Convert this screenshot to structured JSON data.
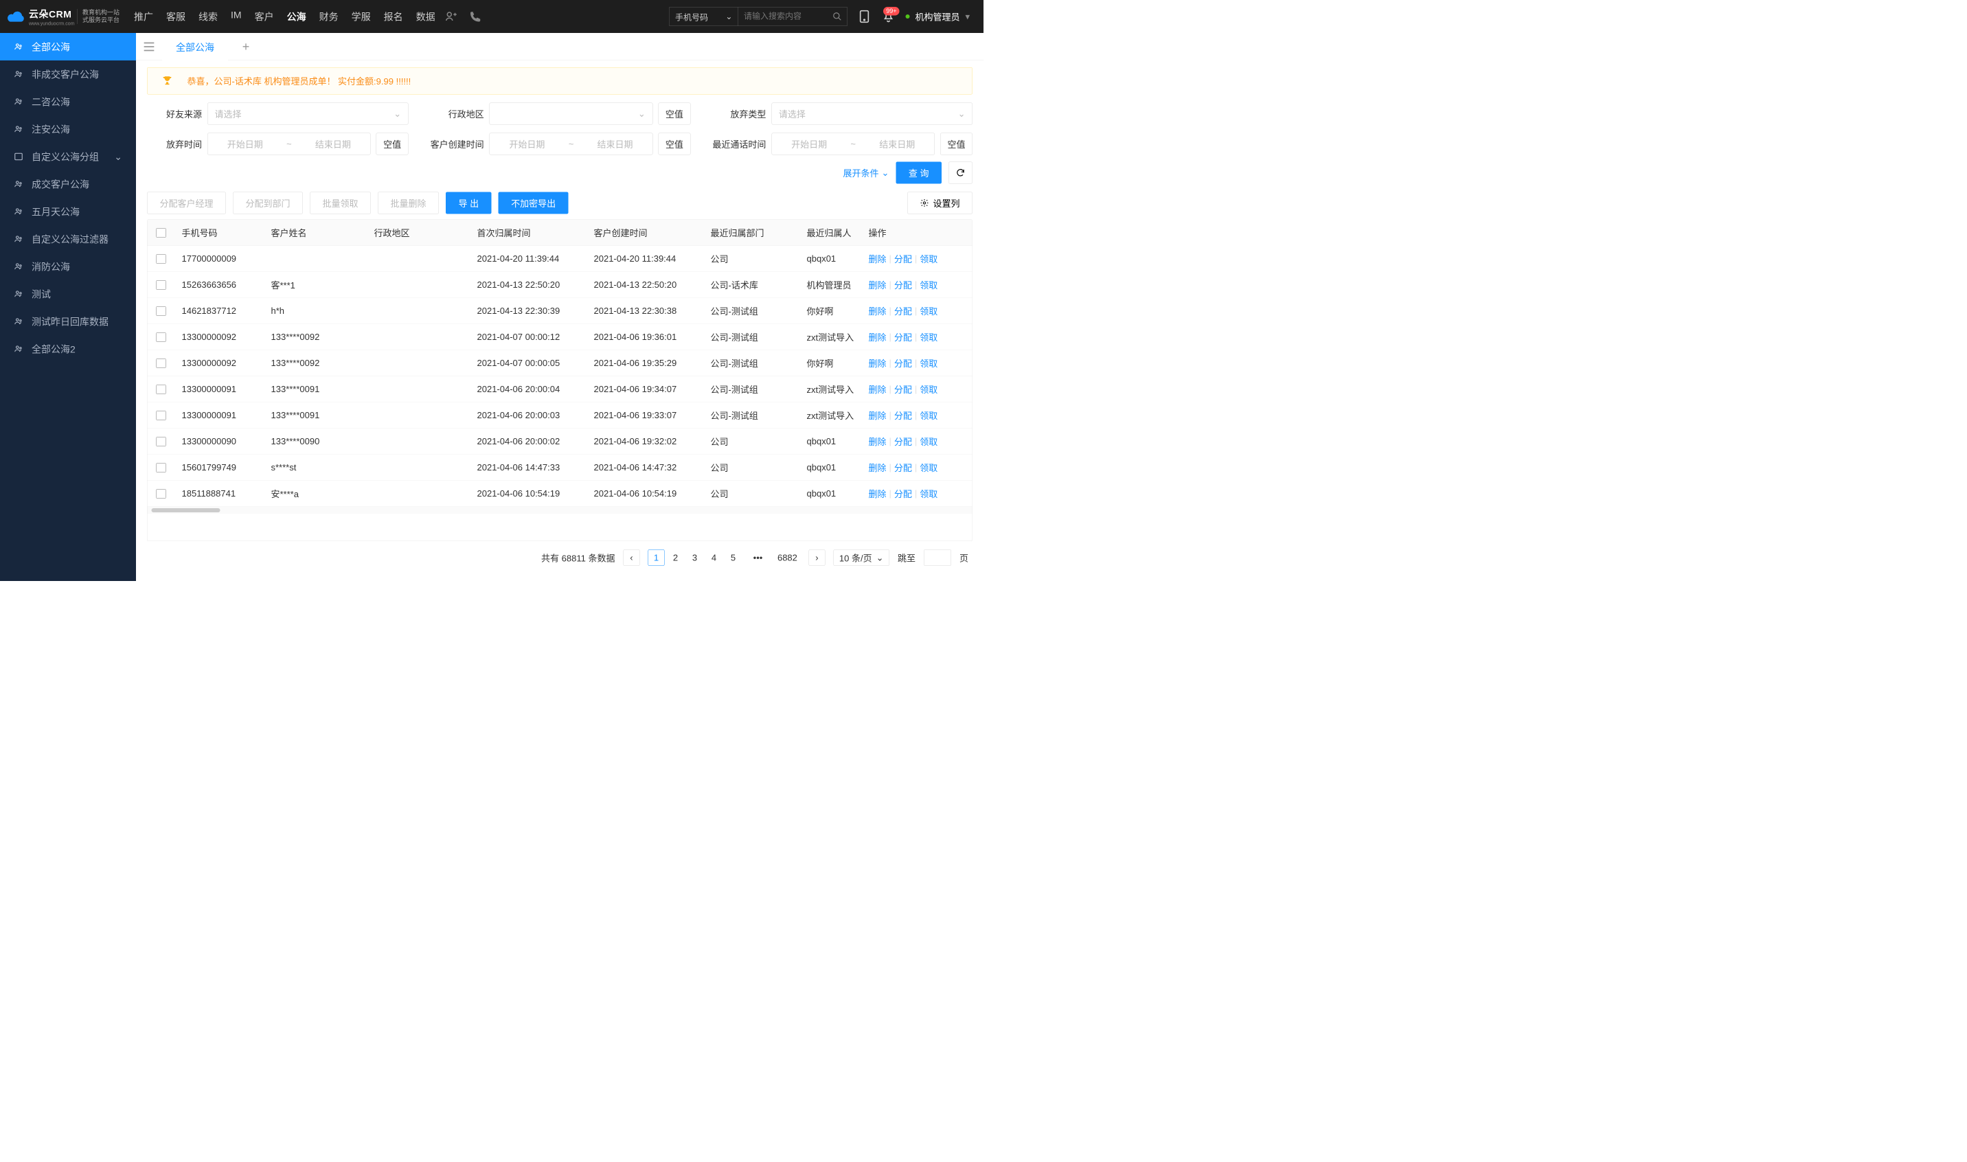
{
  "header": {
    "logo_main": "云朵CRM",
    "logo_url": "www.yunduocrm.com",
    "logo_sub1": "教育机构一站",
    "logo_sub2": "式服务云平台",
    "nav": [
      "推广",
      "客服",
      "线索",
      "IM",
      "客户",
      "公海",
      "财务",
      "学服",
      "报名",
      "数据"
    ],
    "nav_active_index": 5,
    "search_type": "手机号码",
    "search_placeholder": "请输入搜索内容",
    "notif_badge": "99+",
    "user_label": "机构管理员"
  },
  "sidebar": {
    "items": [
      {
        "label": "全部公海",
        "active": true,
        "icon": "users"
      },
      {
        "label": "非成交客户公海",
        "icon": "users"
      },
      {
        "label": "二咨公海",
        "icon": "users"
      },
      {
        "label": "注安公海",
        "icon": "users"
      },
      {
        "label": "自定义公海分组",
        "icon": "folder",
        "expandable": true
      },
      {
        "label": "成交客户公海",
        "icon": "users"
      },
      {
        "label": "五月天公海",
        "icon": "users"
      },
      {
        "label": "自定义公海过滤器",
        "icon": "users"
      },
      {
        "label": "消防公海",
        "icon": "users"
      },
      {
        "label": "测试",
        "icon": "users"
      },
      {
        "label": "测试昨日回库数据",
        "icon": "users"
      },
      {
        "label": "全部公海2",
        "icon": "users"
      }
    ]
  },
  "tabs": {
    "items": [
      "全部公海"
    ],
    "active_index": 0
  },
  "banner": {
    "text": "恭喜，公司-话术库  机构管理员成单！  实付金额:9.99 !!!!!!"
  },
  "filters": {
    "friend_source": {
      "label": "好友来源",
      "placeholder": "请选择"
    },
    "admin_region": {
      "label": "行政地区",
      "placeholder": ""
    },
    "abandon_type": {
      "label": "放弃类型",
      "placeholder": "请选择"
    },
    "abandon_time": {
      "label": "放弃时间",
      "start": "开始日期",
      "end": "结束日期"
    },
    "customer_create_time": {
      "label": "客户创建时间",
      "start": "开始日期",
      "end": "结束日期"
    },
    "last_call_time": {
      "label": "最近通话时间",
      "start": "开始日期",
      "end": "结束日期"
    },
    "null_btn": "空值",
    "expand_label": "展开条件",
    "query_label": "查 询"
  },
  "actions": {
    "assign_manager": "分配客户经理",
    "assign_dept": "分配到部门",
    "batch_claim": "批量领取",
    "batch_delete": "批量删除",
    "export": "导 出",
    "export_plain": "不加密导出",
    "settings_col": "设置列"
  },
  "table": {
    "headers": {
      "phone": "手机号码",
      "name": "客户姓名",
      "region": "行政地区",
      "first_time": "首次归属时间",
      "create_time": "客户创建时间",
      "dept": "最近归属部门",
      "person": "最近归属人",
      "ops": "操作"
    },
    "ops": {
      "delete": "删除",
      "assign": "分配",
      "claim": "领取"
    },
    "rows": [
      {
        "phone": "17700000009",
        "name": "",
        "region": "",
        "first_time": "2021-04-20 11:39:44",
        "create_time": "2021-04-20 11:39:44",
        "dept": "公司",
        "person": "qbqx01"
      },
      {
        "phone": "15263663656",
        "name": "客***1",
        "region": "",
        "first_time": "2021-04-13 22:50:20",
        "create_time": "2021-04-13 22:50:20",
        "dept": "公司-话术库",
        "person": "机构管理员"
      },
      {
        "phone": "14621837712",
        "name": "h*h",
        "region": "",
        "first_time": "2021-04-13 22:30:39",
        "create_time": "2021-04-13 22:30:38",
        "dept": "公司-测试组",
        "person": "你好啊"
      },
      {
        "phone": "13300000092",
        "name": "133****0092",
        "region": "",
        "first_time": "2021-04-07 00:00:12",
        "create_time": "2021-04-06 19:36:01",
        "dept": "公司-测试组",
        "person": "zxt测试导入"
      },
      {
        "phone": "13300000092",
        "name": "133****0092",
        "region": "",
        "first_time": "2021-04-07 00:00:05",
        "create_time": "2021-04-06 19:35:29",
        "dept": "公司-测试组",
        "person": "你好啊"
      },
      {
        "phone": "13300000091",
        "name": "133****0091",
        "region": "",
        "first_time": "2021-04-06 20:00:04",
        "create_time": "2021-04-06 19:34:07",
        "dept": "公司-测试组",
        "person": "zxt测试导入"
      },
      {
        "phone": "13300000091",
        "name": "133****0091",
        "region": "",
        "first_time": "2021-04-06 20:00:03",
        "create_time": "2021-04-06 19:33:07",
        "dept": "公司-测试组",
        "person": "zxt测试导入"
      },
      {
        "phone": "13300000090",
        "name": "133****0090",
        "region": "",
        "first_time": "2021-04-06 20:00:02",
        "create_time": "2021-04-06 19:32:02",
        "dept": "公司",
        "person": "qbqx01"
      },
      {
        "phone": "15601799749",
        "name": "s****st",
        "region": "",
        "first_time": "2021-04-06 14:47:33",
        "create_time": "2021-04-06 14:47:32",
        "dept": "公司",
        "person": "qbqx01"
      },
      {
        "phone": "18511888741",
        "name": "安****a",
        "region": "",
        "first_time": "2021-04-06 10:54:19",
        "create_time": "2021-04-06 10:54:19",
        "dept": "公司",
        "person": "qbqx01"
      }
    ]
  },
  "pagination": {
    "total_prefix": "共有",
    "total": "68811",
    "total_suffix": "条数据",
    "pages": [
      "1",
      "2",
      "3",
      "4",
      "5"
    ],
    "last_page": "6882",
    "per_page": "10 条/页",
    "jump_label": "跳至",
    "page_suffix": "页"
  }
}
